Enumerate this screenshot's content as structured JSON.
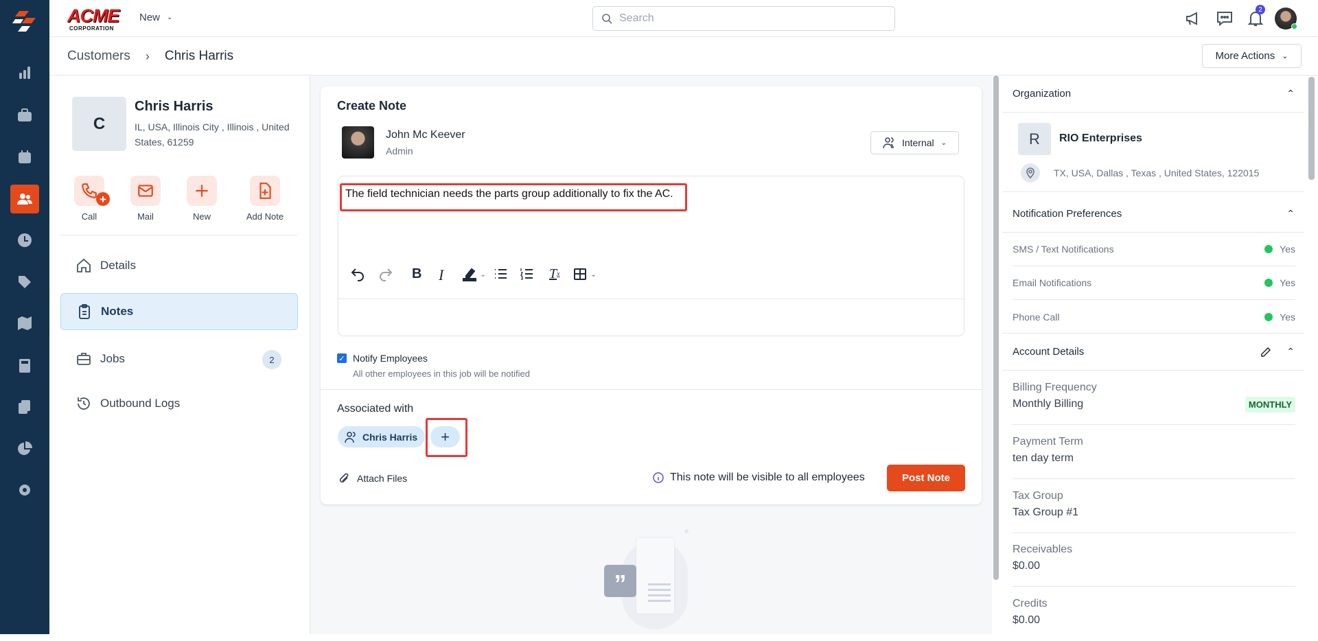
{
  "header": {
    "logo_text": "ACME",
    "logo_sub": "CORPORATION",
    "new_label": "New",
    "search_placeholder": "Search",
    "notification_count": "2"
  },
  "breadcrumb": {
    "parent": "Customers",
    "current": "Chris Harris"
  },
  "more_actions": "More Actions",
  "customer": {
    "initial": "C",
    "name": "Chris Harris",
    "address": "IL, USA, Illinois City , Illinois , United States, 61259"
  },
  "actions": [
    {
      "label": "Call"
    },
    {
      "label": "Mail"
    },
    {
      "label": "New"
    },
    {
      "label": "Add Note"
    }
  ],
  "nav": [
    {
      "label": "Details"
    },
    {
      "label": "Notes"
    },
    {
      "label": "Jobs",
      "badge": "2"
    },
    {
      "label": "Outbound Logs"
    }
  ],
  "note": {
    "title": "Create Note",
    "author": "John Mc Keever",
    "role": "Admin",
    "visibility": "Internal",
    "body": "The field technician needs the parts group additionally to fix the AC.",
    "notify_label": "Notify Employees",
    "notify_checked": true,
    "notify_sub": "All other employees in this job will be notified",
    "associated_label": "Associated with",
    "associated_chip": "Chris Harris",
    "add_label": "+",
    "attach_label": "Attach Files",
    "info_text": "This note will be visible to all employees",
    "post_label": "Post Note"
  },
  "organization": {
    "title": "Organization",
    "initial": "R",
    "name": "RIO Enterprises",
    "address": "TX, USA, Dallas , Texas , United States, 122015"
  },
  "notifications": {
    "title": "Notification Preferences",
    "items": [
      {
        "label": "SMS / Text Notifications",
        "value": "Yes"
      },
      {
        "label": "Email Notifications",
        "value": "Yes"
      },
      {
        "label": "Phone Call",
        "value": "Yes"
      }
    ]
  },
  "account": {
    "title": "Account Details",
    "badge": "MONTHLY",
    "items": [
      {
        "label": "Billing Frequency",
        "value": "Monthly Billing"
      },
      {
        "label": "Payment Term",
        "value": "ten day term"
      },
      {
        "label": "Tax Group",
        "value": "Tax Group #1"
      },
      {
        "label": "Receivables",
        "value": "$0.00"
      },
      {
        "label": "Credits",
        "value": "$0.00"
      }
    ]
  },
  "colors": {
    "accent": "#e44a1c",
    "sidebar": "#14324d",
    "chip": "#d6eafb"
  }
}
